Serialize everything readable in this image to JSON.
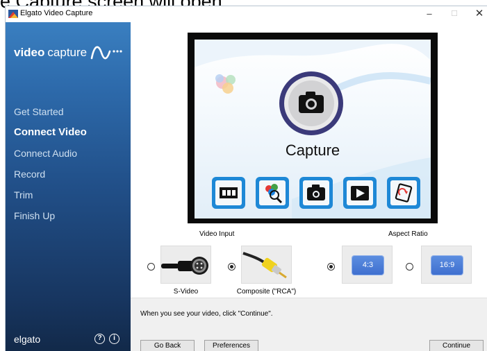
{
  "doc_caption": "e Capture screen will open.",
  "window": {
    "title": "Elgato Video Capture",
    "controls": {
      "minimize": "–",
      "maximize": "☐",
      "close": "✕"
    }
  },
  "sidebar": {
    "brand_bold": "video",
    "brand_light": "capture",
    "nav": [
      {
        "label": "Get Started",
        "active": false
      },
      {
        "label": "Connect Video",
        "active": true
      },
      {
        "label": "Connect Audio",
        "active": false
      },
      {
        "label": "Record",
        "active": false
      },
      {
        "label": "Trim",
        "active": false
      },
      {
        "label": "Finish Up",
        "active": false
      }
    ],
    "footer_logo": "elgato",
    "help_glyph": "?",
    "info_glyph": "i"
  },
  "preview": {
    "screen_title": "Capture"
  },
  "video_input": {
    "label": "Video Input",
    "options": [
      {
        "label": "S-Video",
        "selected": false
      },
      {
        "label": "Composite (\"RCA\")",
        "selected": true
      }
    ]
  },
  "aspect_ratio": {
    "label": "Aspect Ratio",
    "options": [
      {
        "label": "4:3",
        "selected": true
      },
      {
        "label": "16:9",
        "selected": false
      }
    ]
  },
  "info_text": "When you see your video, click \"Continue\".",
  "buttons": {
    "back": "Go Back",
    "preferences": "Preferences",
    "continue": "Continue"
  },
  "colors": {
    "sidebar_top": "#3a7fc0",
    "sidebar_bottom": "#122949",
    "accent_blue": "#3f6fcf",
    "icon_blue": "#1e88d6"
  },
  "icons": [
    "elgato-app-icon",
    "video-capture-wave-icon",
    "help-icon",
    "info-icon",
    "camera-icon",
    "film-strip-icon",
    "color-lens-icon",
    "play-icon",
    "rotate-icon",
    "s-video-cable-icon",
    "rca-cable-icon"
  ]
}
